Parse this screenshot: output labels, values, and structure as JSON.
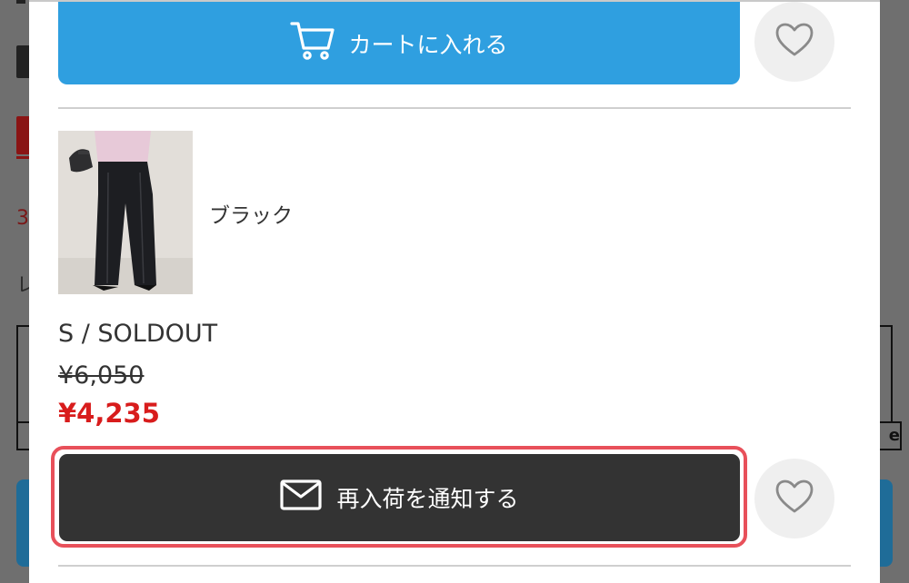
{
  "background": {
    "digit_fragment": "3",
    "letter_fragment": "レ",
    "right_edge_fragment": "e"
  },
  "cart_button": {
    "label": "カートに入れる",
    "icon": "cart-icon",
    "color": "#2f9fe0"
  },
  "favorite_icon": "heart-icon",
  "variant": {
    "color_name": "ブラック",
    "size_status": "S / SOLDOUT",
    "original_price": "¥6,050",
    "sale_price": "¥4,235",
    "sale_color": "#d81c1c"
  },
  "notify_button": {
    "label": "再入荷を通知する",
    "icon": "mail-icon",
    "color": "#333333",
    "highlight": "#e8505a"
  }
}
